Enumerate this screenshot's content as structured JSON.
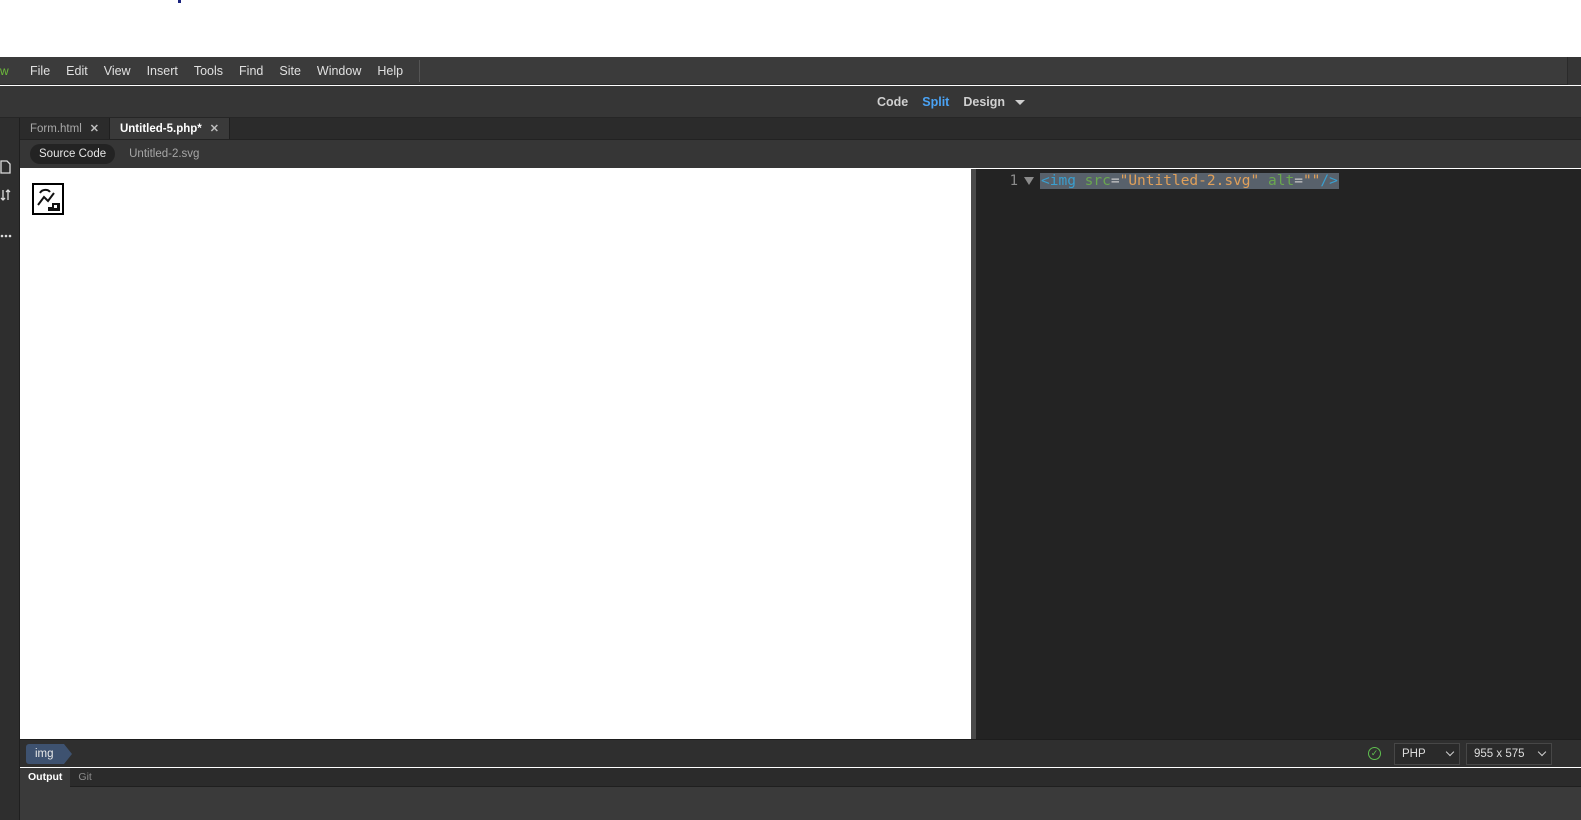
{
  "menubar": {
    "brand_glyph": "w",
    "items": [
      "File",
      "Edit",
      "View",
      "Insert",
      "Tools",
      "Find",
      "Site",
      "Window",
      "Help"
    ]
  },
  "viewbar": {
    "code": "Code",
    "split": "Split",
    "design": "Design",
    "active": "Split"
  },
  "tabs": [
    {
      "label": "Form.html",
      "active": false
    },
    {
      "label": "Untitled-5.php*",
      "active": true
    }
  ],
  "related_files": {
    "source_code": "Source Code",
    "file": "Untitled-2.svg"
  },
  "code": {
    "line_number": "1",
    "tag_open": "<img",
    "attr1": "src",
    "val1": "\"Untitled-2.svg\"",
    "attr2": "alt",
    "val2": "\"\"",
    "tag_close": "/>"
  },
  "statusbar": {
    "breadcrumb": "img",
    "language": "PHP",
    "window_size": "955 x 575"
  },
  "panel_tabs": {
    "output": "Output",
    "git": "Git"
  },
  "colors": {
    "accent_active_view": "#4aa3f5",
    "brand": "#6dbb3b",
    "ok": "#5fbf4f"
  }
}
